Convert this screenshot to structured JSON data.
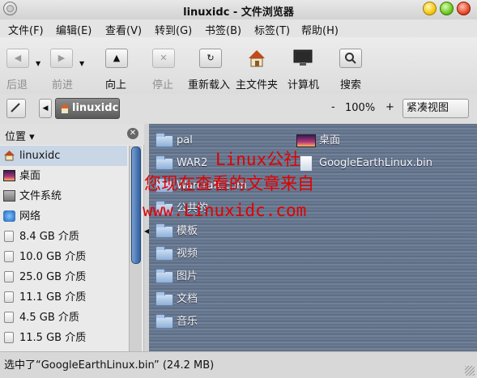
{
  "window": {
    "title": "linuxidc - 文件浏览器"
  },
  "menubar": [
    "文件(F)",
    "编辑(E)",
    "查看(V)",
    "转到(G)",
    "书签(B)",
    "标签(T)",
    "帮助(H)"
  ],
  "toolbar": {
    "back": "后退",
    "forward": "前进",
    "up": "向上",
    "stop": "停止",
    "reload": "重新载入",
    "home": "主文件夹",
    "computer": "计算机",
    "search": "搜索"
  },
  "location": {
    "crumb": "linuxidc",
    "zoom": "100%",
    "zoom_minus": "-",
    "zoom_plus": "+",
    "view_mode": "紧凑视图"
  },
  "sidebar": {
    "header": "位置",
    "items": [
      {
        "label": "linuxidc",
        "icon": "home-icon"
      },
      {
        "label": "桌面",
        "icon": "desktop-icon"
      },
      {
        "label": "文件系统",
        "icon": "filesystem-icon"
      },
      {
        "label": "网络",
        "icon": "network-icon"
      },
      {
        "label": "8.4 GB 介质",
        "icon": "drive-icon"
      },
      {
        "label": "10.0 GB 介质",
        "icon": "drive-icon"
      },
      {
        "label": "25.0 GB 介质",
        "icon": "drive-icon"
      },
      {
        "label": "11.1 GB 介质",
        "icon": "drive-icon"
      },
      {
        "label": "4.5 GB 介质",
        "icon": "drive-icon"
      },
      {
        "label": "11.5 GB 介质",
        "icon": "drive-icon"
      }
    ]
  },
  "files": {
    "col1": [
      "pal",
      "WAR2",
      "Warcraft.com",
      "公共的",
      "模板",
      "视频",
      "图片",
      "文档",
      "音乐"
    ],
    "col2": [
      "桌面",
      "GoogleEarthLinux.bin"
    ]
  },
  "watermark": {
    "line1": "Linux公社",
    "line2": "您现在查看的文章来自",
    "line3": "www.Linuxidc.com"
  },
  "status": {
    "text": "选中了“GoogleEarthLinux.bin” (24.2 MB)"
  },
  "colors": {
    "watermark": "#e00000",
    "selection": "#c9d6e6"
  }
}
